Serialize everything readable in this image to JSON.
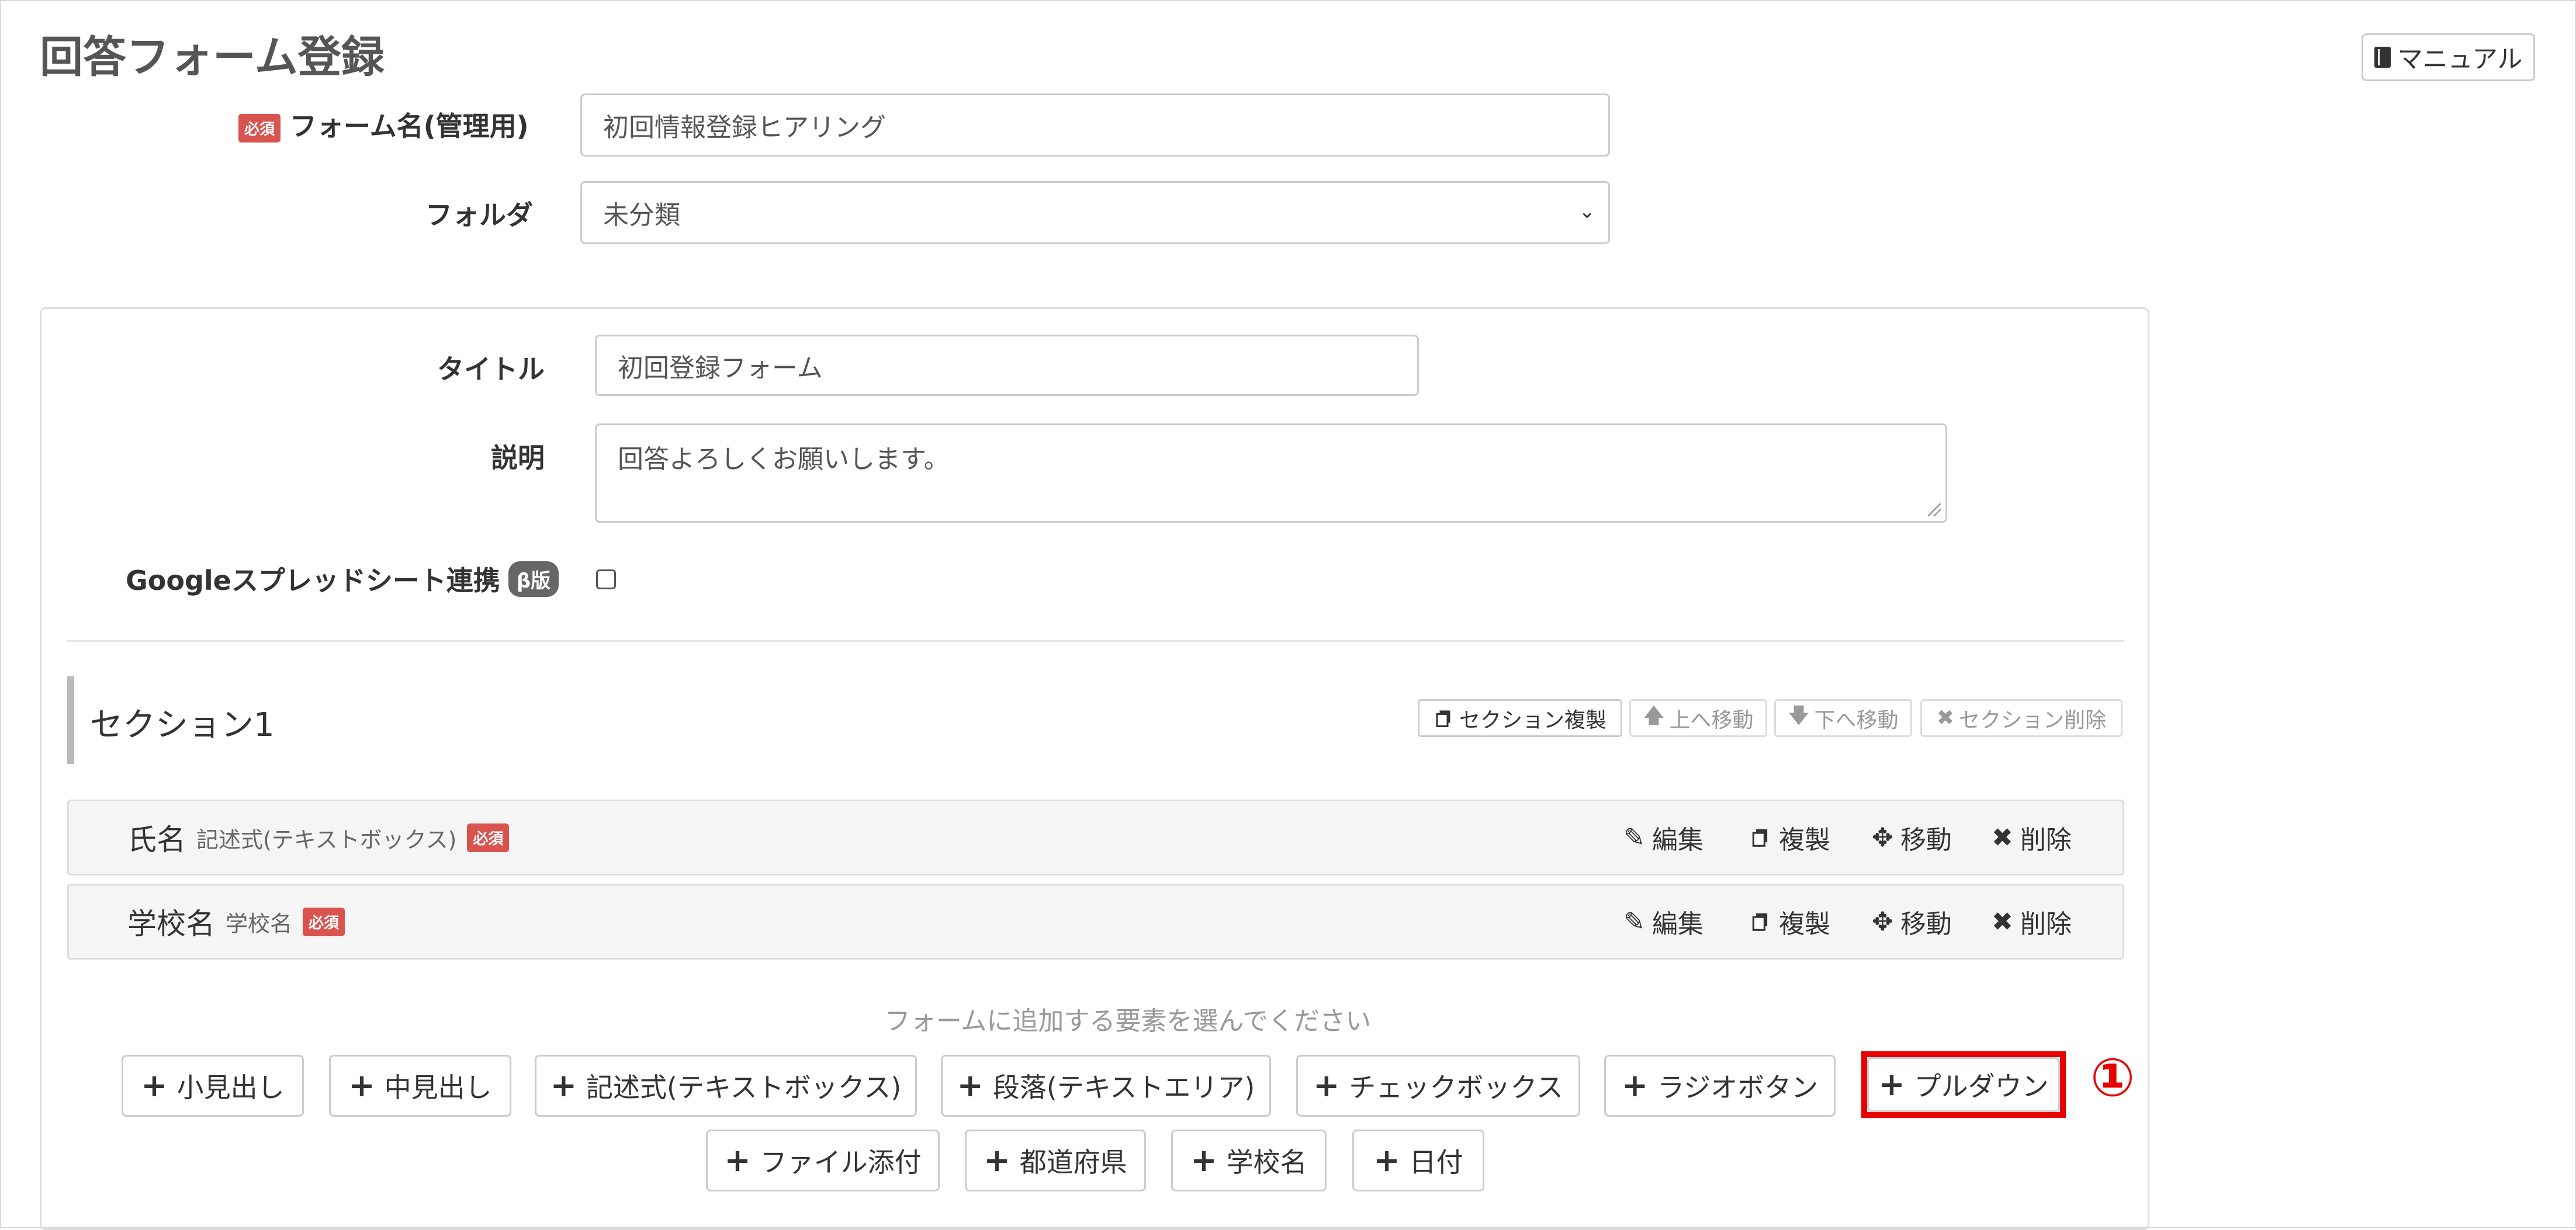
{
  "page": {
    "title": "回答フォーム登録",
    "manual_label": "マニュアル"
  },
  "form": {
    "required_badge": "必須",
    "name_label": "フォーム名(管理用)",
    "name_value": "初回情報登録ヒアリング",
    "folder_label": "フォルダ",
    "folder_value": "未分類"
  },
  "panel": {
    "title_label": "タイトル",
    "title_value": "初回登録フォーム",
    "desc_label": "説明",
    "desc_value": "回答よろしくお願いします。",
    "sheets_label": "Googleスプレッドシート連携",
    "beta_badge": "β版",
    "sheets_checked": false
  },
  "section": {
    "title": "セクション1",
    "buttons": [
      {
        "label": "セクション複製",
        "icon": "copy-icon",
        "enabled": true
      },
      {
        "label": "上へ移動",
        "icon": "arrow-up-icon",
        "enabled": false
      },
      {
        "label": "下へ移動",
        "icon": "arrow-down-icon",
        "enabled": false
      },
      {
        "label": "セクション削除",
        "icon": "close-icon",
        "enabled": false
      }
    ]
  },
  "items": [
    {
      "name": "氏名",
      "type": "記述式(テキストボックス)",
      "required": "必須"
    },
    {
      "name": "学校名",
      "type": "学校名",
      "required": "必須"
    }
  ],
  "item_actions": {
    "edit": "編集",
    "copy": "複製",
    "move": "移動",
    "delete": "削除"
  },
  "add": {
    "hint": "フォームに追加する要素を選んでください",
    "buttons": [
      "小見出し",
      "中見出し",
      "記述式(テキストボックス)",
      "段落(テキストエリア)",
      "チェックボックス",
      "ラジオボタン",
      "プルダウン",
      "ファイル添付",
      "都道府県",
      "学校名",
      "日付"
    ]
  },
  "annotation": {
    "marker": "①",
    "color": "#e60000"
  },
  "colors": {
    "required": "#d9534f",
    "beta": "#666666",
    "border": "#cccccc"
  }
}
